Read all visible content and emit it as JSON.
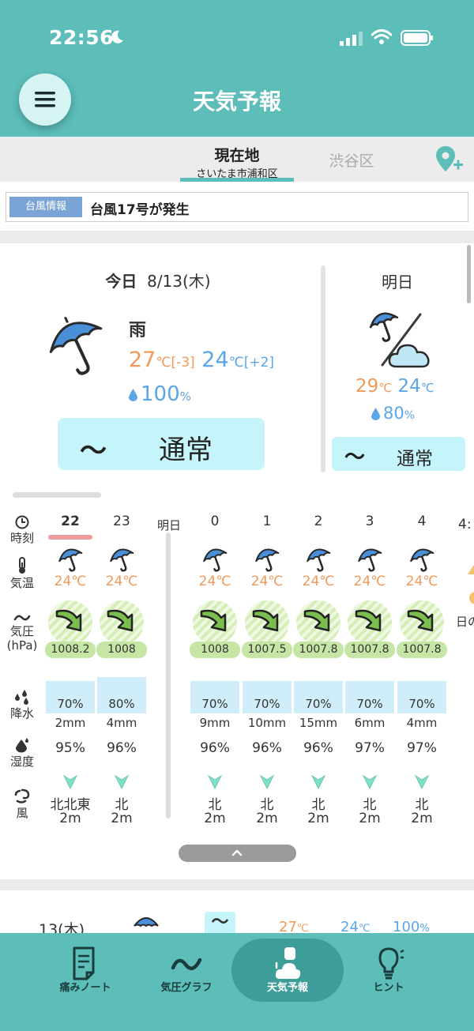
{
  "status_bar": {
    "time": "22:56"
  },
  "header": {
    "title": "天気予報",
    "menu_icon": "hamburger-icon"
  },
  "locations": {
    "current": {
      "label": "現在地",
      "sub": "さいたま市浦和区"
    },
    "other": {
      "label": "渋谷区"
    },
    "add_icon": "add-location-icon"
  },
  "alert": {
    "badge": "台風情報",
    "message": "台風17号が発生"
  },
  "today": {
    "label": "今日",
    "date": "8/13(木)",
    "condition": "雨",
    "high": "27",
    "high_unit": "℃",
    "high_diff": "[-3]",
    "low": "24",
    "low_unit": "℃",
    "low_diff": "[+2]",
    "pop": "100",
    "pop_unit": "%",
    "status_symbol": "〜",
    "status": "通常"
  },
  "tomorrow": {
    "label": "明日",
    "high": "29",
    "low": "24",
    "unit": "℃",
    "pop": "80",
    "pop_unit": "%",
    "status_symbol": "〜",
    "status": "通常"
  },
  "hourly": {
    "row_labels": {
      "time": "時刻",
      "temp": "気温",
      "pressure": "気圧",
      "pressure_unit": "(hPa)",
      "rain": "降水",
      "humidity": "湿度",
      "wind": "風"
    },
    "separator_label": "明日",
    "hours": [
      {
        "hour": "22",
        "temp": "24℃",
        "pressure": "1008.2",
        "pop": "70%",
        "mm": "2mm",
        "humidity": "95%",
        "dir": "北北東",
        "speed": "2m"
      },
      {
        "hour": "23",
        "temp": "24℃",
        "pressure": "1008",
        "pop": "80%",
        "mm": "4mm",
        "humidity": "96%",
        "dir": "北",
        "speed": "2m"
      },
      {
        "hour": "0",
        "temp": "24℃",
        "pressure": "1008",
        "pop": "70%",
        "mm": "9mm",
        "humidity": "96%",
        "dir": "北",
        "speed": "2m"
      },
      {
        "hour": "1",
        "temp": "24℃",
        "pressure": "1007.5",
        "pop": "70%",
        "mm": "10mm",
        "humidity": "96%",
        "dir": "北",
        "speed": "2m"
      },
      {
        "hour": "2",
        "temp": "24℃",
        "pressure": "1007.8",
        "pop": "70%",
        "mm": "15mm",
        "humidity": "96%",
        "dir": "北",
        "speed": "2m"
      },
      {
        "hour": "3",
        "temp": "24℃",
        "pressure": "1007.8",
        "pop": "70%",
        "mm": "6mm",
        "humidity": "97%",
        "dir": "北",
        "speed": "2m"
      },
      {
        "hour": "4",
        "temp": "24℃",
        "pressure": "1007.8",
        "pop": "70%",
        "mm": "4mm",
        "humidity": "97%",
        "dir": "北",
        "speed": "2m"
      }
    ],
    "cut_hour": "4:",
    "cut_text": "日の"
  },
  "daily": [
    {
      "date": "13(木)",
      "status_symbol": "〜",
      "high": "27",
      "low": "24",
      "unit": "℃",
      "pop": "100",
      "pop_unit": "%"
    }
  ],
  "bottom_nav": [
    {
      "label": "痛みノート",
      "icon": "note-icon"
    },
    {
      "label": "気圧グラフ",
      "icon": "wave-icon"
    },
    {
      "label": "天気予報",
      "icon": "weather-icon",
      "active": true
    },
    {
      "label": "ヒント",
      "icon": "bulb-icon"
    }
  ],
  "colors": {
    "teal": "#5cbdb9",
    "teal_dark": "#3d9d99",
    "orange": "#ef9a5a",
    "blue": "#5aa6e6",
    "cyan_box": "#c6f4fb",
    "umbrella": "#4a90d9"
  }
}
